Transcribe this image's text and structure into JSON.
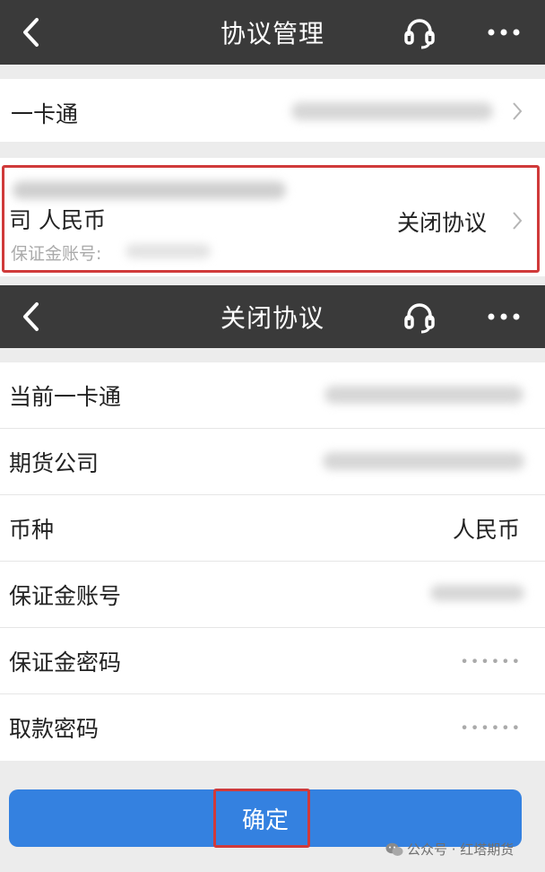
{
  "screen1": {
    "nav_title": "协议管理",
    "card_row_label": "一卡通",
    "agreement_title_line2": "司 人民币",
    "agreement_account_label": "保证金账号:",
    "close_agreement_label": "关闭协议"
  },
  "screen2": {
    "nav_title": "关闭协议",
    "rows": [
      {
        "label": "当前一卡通",
        "value": ""
      },
      {
        "label": "期货公司",
        "value": ""
      },
      {
        "label": "币种",
        "value": "人民币"
      },
      {
        "label": "保证金账号",
        "value": ""
      },
      {
        "label": "保证金密码",
        "value": "••••••"
      },
      {
        "label": "取款密码",
        "value": "••••••"
      }
    ],
    "confirm_label": "确定"
  },
  "watermark": {
    "icon": "wechat-icon",
    "text": "公众号 · 红塔期货"
  },
  "colors": {
    "navbar": "#3a3a3a",
    "accent": "#3481e0",
    "highlight": "#d03a3a"
  }
}
